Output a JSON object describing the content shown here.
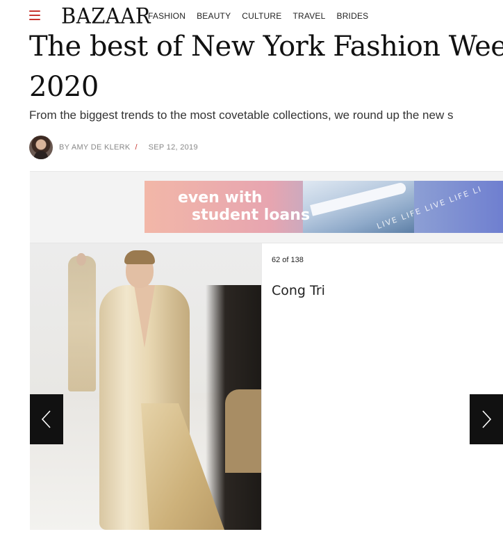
{
  "header": {
    "logo": "BAZAAR",
    "nav": [
      "FASHION",
      "BEAUTY",
      "CULTURE",
      "TRAVEL",
      "BRIDES"
    ],
    "menu_icon": "hamburger-menu-icon",
    "accent_color": "#c8352f"
  },
  "article": {
    "headline_line1": "The best of New York Fashion Week spr",
    "headline_line2": "2020",
    "dek": "From the biggest trends to the most covetable collections, we round up the new s",
    "byline": {
      "author": "BY AMY DE KLERK",
      "separator": "/",
      "date": "SEP 12, 2019"
    }
  },
  "ad": {
    "line1": "even with",
    "line2": "student loans",
    "tagline": "LIVE LIFE LIVE LIFE LI"
  },
  "gallery": {
    "counter": "62 of 138",
    "slide_title": "Cong Tri",
    "prev_icon": "chevron-left-icon",
    "next_icon": "chevron-right-icon"
  }
}
